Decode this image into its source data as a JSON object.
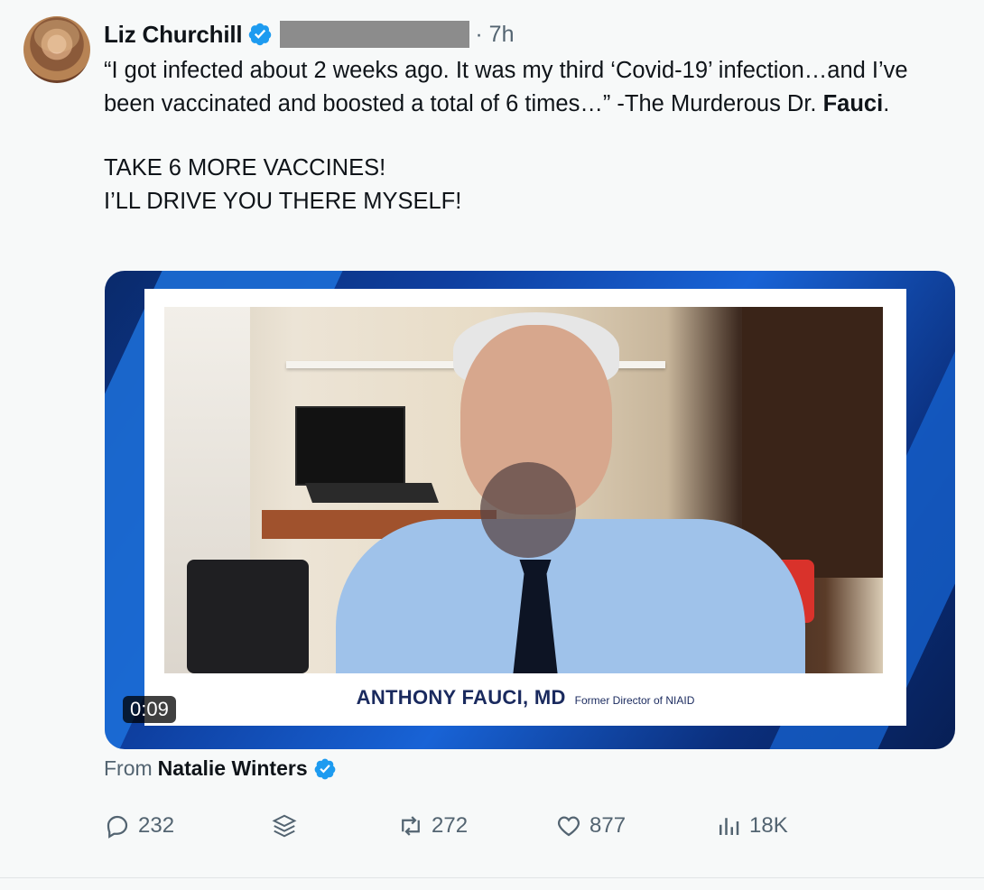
{
  "author": {
    "name": "Liz Churchill",
    "time": "· 7h"
  },
  "tweet": {
    "line1": "“I got infected about 2 weeks ago. It was my third ‘Covid-19’ infection…and I’ve been vaccinated and boosted a total of 6 times…” -The Murderous Dr. ",
    "line1_bold": "Fauci",
    "line1_end": ".",
    "line2": "TAKE 6 MORE VACCINES!",
    "line3": "I’LL DRIVE YOU THERE MYSELF!"
  },
  "video": {
    "caption_name": "ANTHONY FAUCI, MD",
    "caption_title": "Former Director of NIAID",
    "duration": "0:09"
  },
  "attribution": {
    "prefix": "From",
    "source": "Natalie Winters"
  },
  "actions": {
    "replies": "232",
    "retweets": "272",
    "likes": "877",
    "views": "18K"
  },
  "colors": {
    "verified": "#1d9bf0",
    "text_secondary": "#536471"
  }
}
